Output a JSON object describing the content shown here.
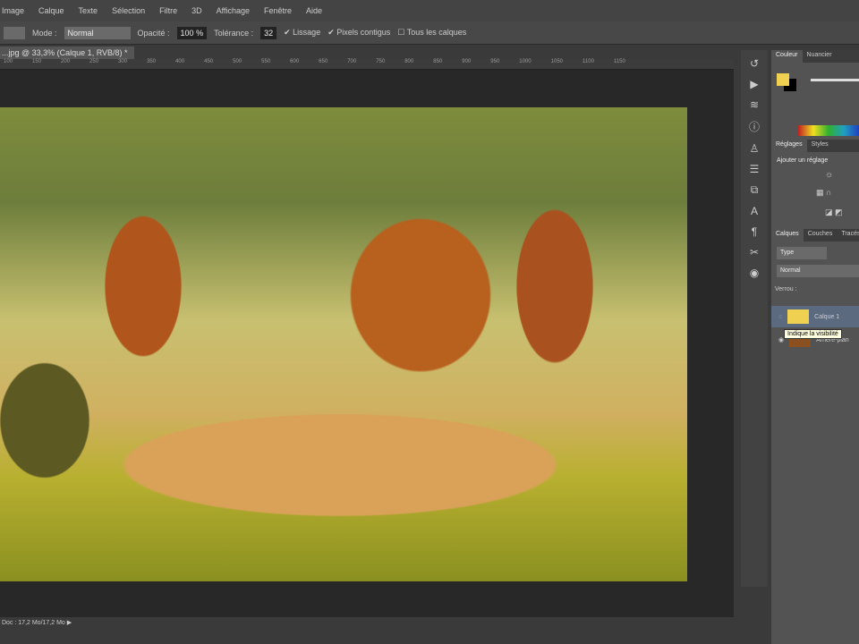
{
  "menu": [
    "Image",
    "Calque",
    "Texte",
    "Sélection",
    "Filtre",
    "3D",
    "Affichage",
    "Fenêtre",
    "Aide"
  ],
  "options": {
    "mode_label": "Mode :",
    "mode_value": "Normal",
    "opacity_label": "Opacité :",
    "opacity_value": "100 %",
    "tolerance_label": "Tolérance :",
    "tolerance_value": "32",
    "lissage": "Lissage",
    "pixels_contigus": "Pixels contigus",
    "tous_calques": "Tous les calques"
  },
  "document_tab": "...jpg @ 33,3% (Calque 1, RVB/8) *",
  "ruler_ticks": [
    "100",
    "150",
    "200",
    "250",
    "300",
    "350",
    "400",
    "450",
    "500",
    "550",
    "600",
    "650",
    "700",
    "750",
    "800",
    "850",
    "900",
    "950",
    "1000",
    "1050",
    "1100",
    "1150"
  ],
  "status": "Doc : 17,2 Mo/17,2 Mo",
  "panels": {
    "color_tabs": [
      "Couleur",
      "Nuancier"
    ],
    "adjust_tabs": [
      "Réglages",
      "Styles"
    ],
    "adjust_title": "Ajouter un réglage",
    "layers_tabs": [
      "Calques",
      "Couches",
      "Tracés"
    ],
    "kind_filter": "Type",
    "blend_mode": "Normal",
    "lock_label": "Verrou :",
    "layers": [
      "Calque 1",
      "Arrière-plan"
    ],
    "tooltip": "Indique la visibilité"
  },
  "colors": {
    "foreground": "#f0d050",
    "background": "#000000"
  }
}
